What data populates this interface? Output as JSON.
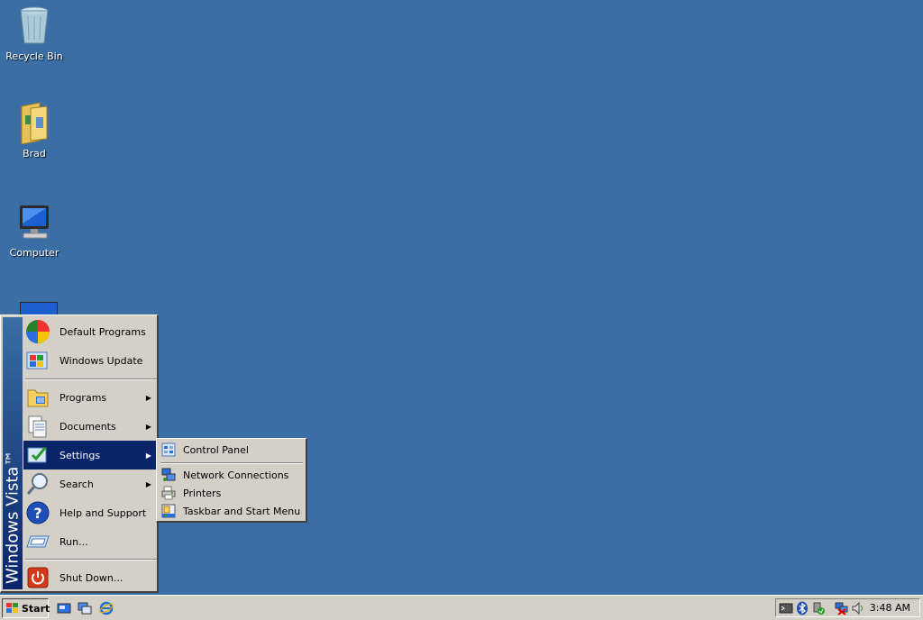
{
  "desktop": {
    "icons": [
      {
        "label": "Recycle Bin",
        "icon": "recycle-bin-icon"
      },
      {
        "label": "Brad",
        "icon": "user-folder-icon"
      },
      {
        "label": "Computer",
        "icon": "computer-icon"
      }
    ]
  },
  "start_menu": {
    "band_text": "Windows Vista™",
    "items": [
      {
        "label": "Default Programs",
        "icon": "default-programs-icon"
      },
      {
        "label": "Windows Update",
        "icon": "windows-update-icon"
      },
      {
        "label": "Programs",
        "icon": "programs-icon"
      },
      {
        "label": "Documents",
        "icon": "documents-icon"
      },
      {
        "label": "Settings",
        "icon": "settings-icon"
      },
      {
        "label": "Search",
        "icon": "search-icon"
      },
      {
        "label": "Help and Support",
        "icon": "help-icon"
      },
      {
        "label": "Run...",
        "icon": "run-icon"
      },
      {
        "label": "Shut Down...",
        "icon": "shutdown-icon"
      }
    ]
  },
  "settings_submenu": {
    "items": [
      {
        "label": "Control Panel",
        "icon": "control-panel-icon"
      },
      {
        "label": "Network Connections",
        "icon": "network-connections-icon"
      },
      {
        "label": "Printers",
        "icon": "printers-icon"
      },
      {
        "label": "Taskbar and Start Menu",
        "icon": "taskbar-start-menu-icon"
      }
    ]
  },
  "taskbar": {
    "start_label": "Start",
    "clock": "3:48 AM"
  },
  "colors": {
    "desktop": "#3a6ea5",
    "highlight": "#0a246a",
    "face": "#d4d0c8"
  }
}
